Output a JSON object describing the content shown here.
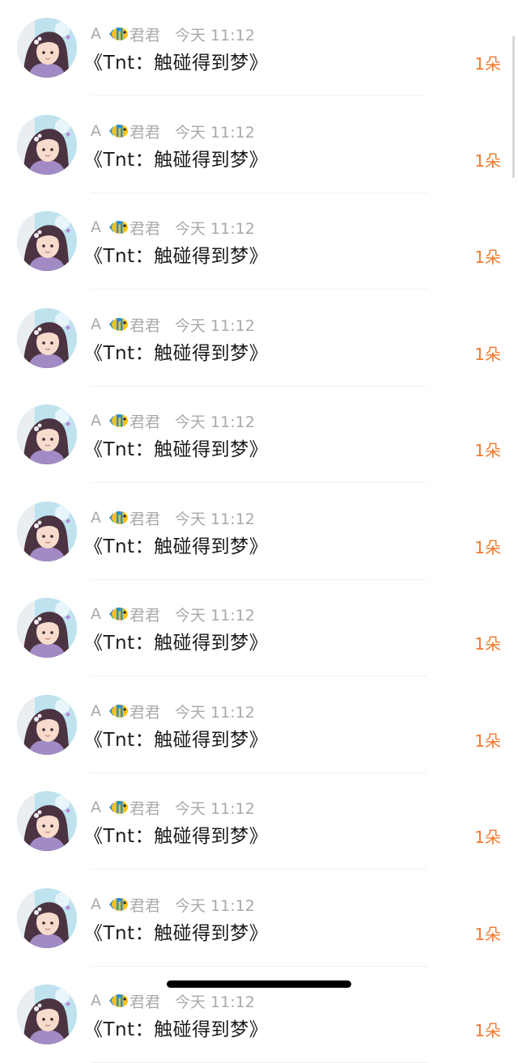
{
  "accent_color": "#f5792c",
  "items": [
    {
      "user_prefix": "A",
      "user_icon": "fish-emoji-icon",
      "user_name": "君君",
      "time": "今天 11:12",
      "title": "《Tnt：触碰得到梦》",
      "count": "1朵"
    },
    {
      "user_prefix": "A",
      "user_icon": "fish-emoji-icon",
      "user_name": "君君",
      "time": "今天 11:12",
      "title": "《Tnt：触碰得到梦》",
      "count": "1朵"
    },
    {
      "user_prefix": "A",
      "user_icon": "fish-emoji-icon",
      "user_name": "君君",
      "time": "今天 11:12",
      "title": "《Tnt：触碰得到梦》",
      "count": "1朵"
    },
    {
      "user_prefix": "A",
      "user_icon": "fish-emoji-icon",
      "user_name": "君君",
      "time": "今天 11:12",
      "title": "《Tnt：触碰得到梦》",
      "count": "1朵"
    },
    {
      "user_prefix": "A",
      "user_icon": "fish-emoji-icon",
      "user_name": "君君",
      "time": "今天 11:12",
      "title": "《Tnt：触碰得到梦》",
      "count": "1朵"
    },
    {
      "user_prefix": "A",
      "user_icon": "fish-emoji-icon",
      "user_name": "君君",
      "time": "今天 11:12",
      "title": "《Tnt：触碰得到梦》",
      "count": "1朵"
    },
    {
      "user_prefix": "A",
      "user_icon": "fish-emoji-icon",
      "user_name": "君君",
      "time": "今天 11:12",
      "title": "《Tnt：触碰得到梦》",
      "count": "1朵"
    },
    {
      "user_prefix": "A",
      "user_icon": "fish-emoji-icon",
      "user_name": "君君",
      "time": "今天 11:12",
      "title": "《Tnt：触碰得到梦》",
      "count": "1朵"
    },
    {
      "user_prefix": "A",
      "user_icon": "fish-emoji-icon",
      "user_name": "君君",
      "time": "今天 11:12",
      "title": "《Tnt：触碰得到梦》",
      "count": "1朵"
    },
    {
      "user_prefix": "A",
      "user_icon": "fish-emoji-icon",
      "user_name": "君君",
      "time": "今天 11:12",
      "title": "《Tnt：触碰得到梦》",
      "count": "1朵"
    },
    {
      "user_prefix": "A",
      "user_icon": "fish-emoji-icon",
      "user_name": "君君",
      "time": "今天 11:12",
      "title": "《Tnt：触碰得到梦》",
      "count": "1朵"
    }
  ]
}
